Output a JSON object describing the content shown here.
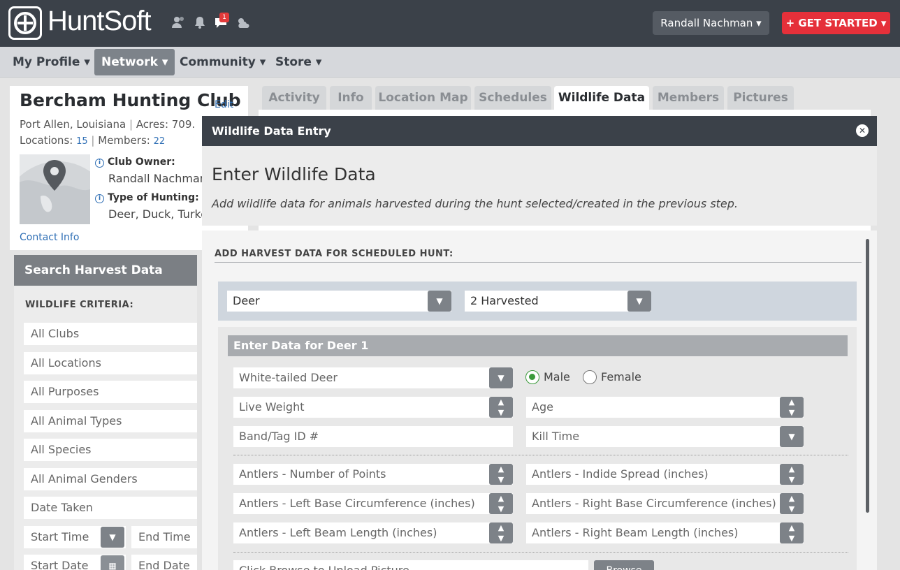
{
  "header": {
    "logo_text": "HuntSoft",
    "icons": [
      "people-icon",
      "bell-icon",
      "chat-icon",
      "weather-icon"
    ],
    "notification_count": "1",
    "user_name": "Randall Nachman ▾",
    "cta_label": "+ GET STARTED ▾",
    "colors": {
      "topbar": "#3b4149",
      "cta": "#e5303a"
    }
  },
  "nav": {
    "items": [
      "My Profile ▾",
      "Network ▾",
      "Community ▾",
      "Store ▾"
    ],
    "active": "Network"
  },
  "club": {
    "name": "Bercham Hunting Club",
    "edit_label": "Edit",
    "location": "Port Allen, Louisiana",
    "acres": "Acres: 709.",
    "locations_label": "Locations:",
    "locations_count": "15",
    "members_label": "Members:",
    "members_count": "22",
    "owner_label": "Club Owner:",
    "owner_value": "Randall Nachman",
    "hunting_label": "Type of Hunting:",
    "hunting_value": "Deer, Duck, Turkey",
    "contact_label": "Contact Info"
  },
  "search": {
    "title": "Search Harvest Data",
    "criteria_label": "WILDLIFE CRITERIA:",
    "fields": [
      "All Clubs",
      "All Locations",
      "All Purposes",
      "All Animal Types",
      "All Species",
      "All Animal Genders",
      "Date Taken"
    ],
    "start_time": "Start Time",
    "end_time": "End Time",
    "start_date": "Start Date",
    "end_date": "End Date"
  },
  "tabs": [
    "Activity",
    "Info",
    "Location Map",
    "Schedules",
    "Wildlife Data",
    "Members",
    "Pictures"
  ],
  "active_tab": "Wildlife Data",
  "modal": {
    "title": "Wildlife Data Entry",
    "heading": "Enter Wildlife Data",
    "description": "Add wildlife data for animals harvested during the hunt selected/created in the previous step.",
    "section_label": "ADD HARVEST DATA FOR SCHEDULED HUNT:",
    "animal_type": "Deer",
    "harvest_count": "2 Harvested",
    "entry_title": "Enter Data for Deer 1",
    "species": "White-tailed Deer",
    "gender_male": "Male",
    "gender_female": "Female",
    "gender_selected": "Male",
    "live_weight": "Live Weight",
    "age": "Age",
    "band_tag": "Band/Tag ID #",
    "kill_time": "Kill Time",
    "antler_points": "Antlers - Number of Points",
    "antler_spread": "Antlers - Indide Spread (inches)",
    "antler_left_base": "Antlers - Left Base Circumference (inches)",
    "antler_right_base": "Antlers - Right Base Circumference (inches)",
    "antler_left_beam": "Antlers - Left Beam Length (inches)",
    "antler_right_beam": "Antlers - Right Beam Length (inches)",
    "upload_placeholder": "Click Browse to Upload Picture",
    "browse_label": "Browse"
  }
}
